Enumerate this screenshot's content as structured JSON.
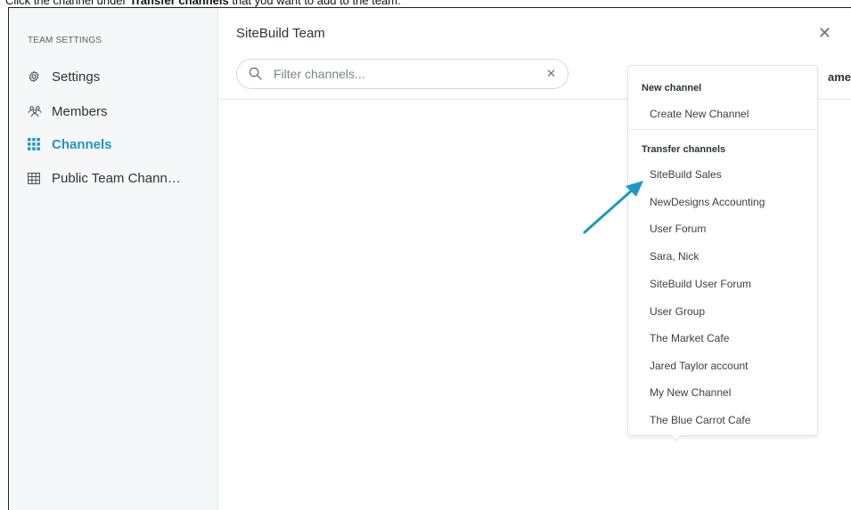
{
  "caption": {
    "prefix": "Click the channel under ",
    "bold": "Transfer channels",
    "suffix": " that you want to add to the team."
  },
  "sidebar": {
    "heading": "TEAM SETTINGS",
    "items": [
      {
        "label": "Settings",
        "icon": "gear-icon",
        "active": false
      },
      {
        "label": "Members",
        "icon": "members-icon",
        "active": false
      },
      {
        "label": "Channels",
        "icon": "channels-grid-icon",
        "active": true
      },
      {
        "label": "Public Team Chann…",
        "icon": "table-icon",
        "active": false
      }
    ]
  },
  "main": {
    "title": "SiteBuild Team",
    "search_placeholder": "Filter channels...",
    "column_header_partial": "ame"
  },
  "dropdown": {
    "new_section": "New channel",
    "create_label": "Create New Channel",
    "transfer_section": "Transfer channels",
    "channels": [
      "SiteBuild Sales",
      "NewDesigns Accounting",
      "User Forum",
      "Sara, Nick",
      "SiteBuild User Forum",
      "User Group",
      "The Market Cafe",
      "Jared Taylor account",
      "My New Channel",
      "The Blue Carrot Cafe"
    ]
  },
  "colors": {
    "accent": "#1e97c2",
    "arrow": "#1b9bc0"
  }
}
